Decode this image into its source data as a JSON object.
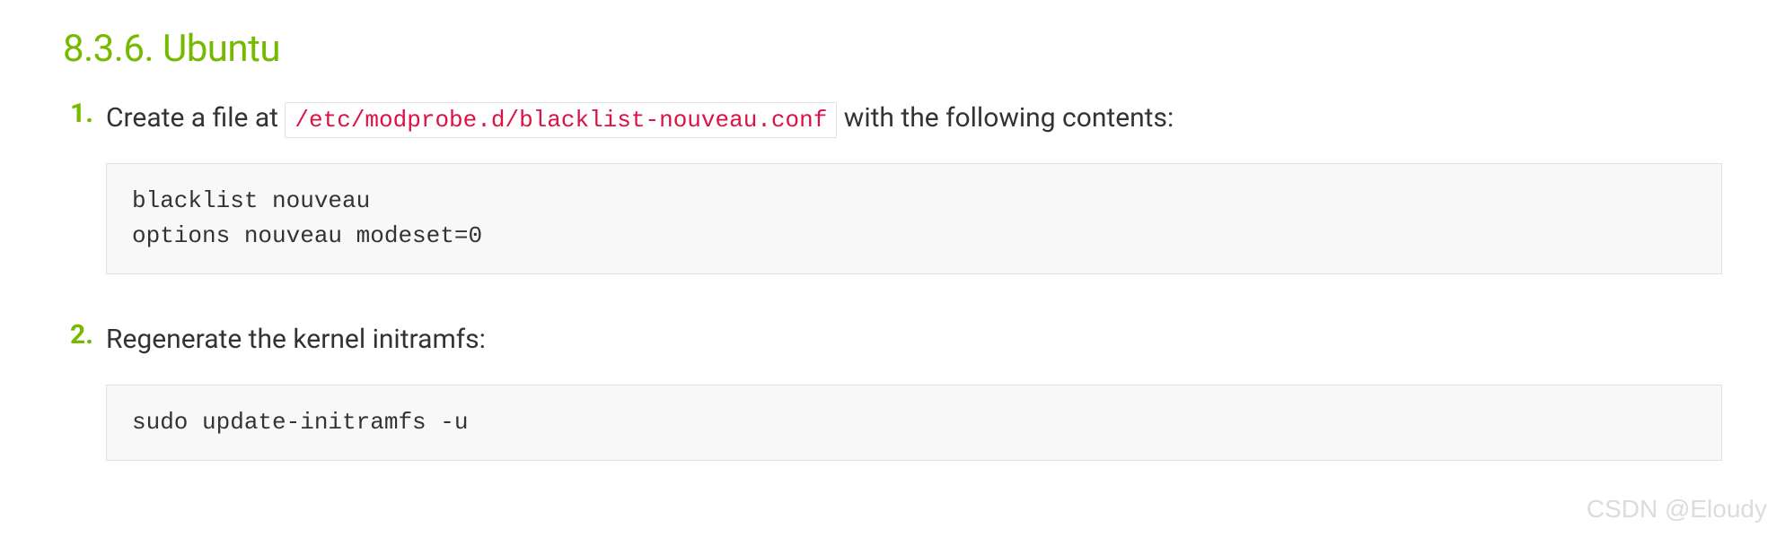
{
  "heading": "8.3.6. Ubuntu",
  "steps": [
    {
      "text_before": "Create a file at ",
      "inline_code": "/etc/modprobe.d/blacklist-nouveau.conf",
      "text_after": " with the following contents:",
      "code_block": "blacklist nouveau\noptions nouveau modeset=0"
    },
    {
      "text_before": "Regenerate the kernel initramfs:",
      "inline_code": "",
      "text_after": "",
      "code_block": "sudo update-initramfs -u"
    }
  ],
  "watermark": "CSDN @Eloudy"
}
